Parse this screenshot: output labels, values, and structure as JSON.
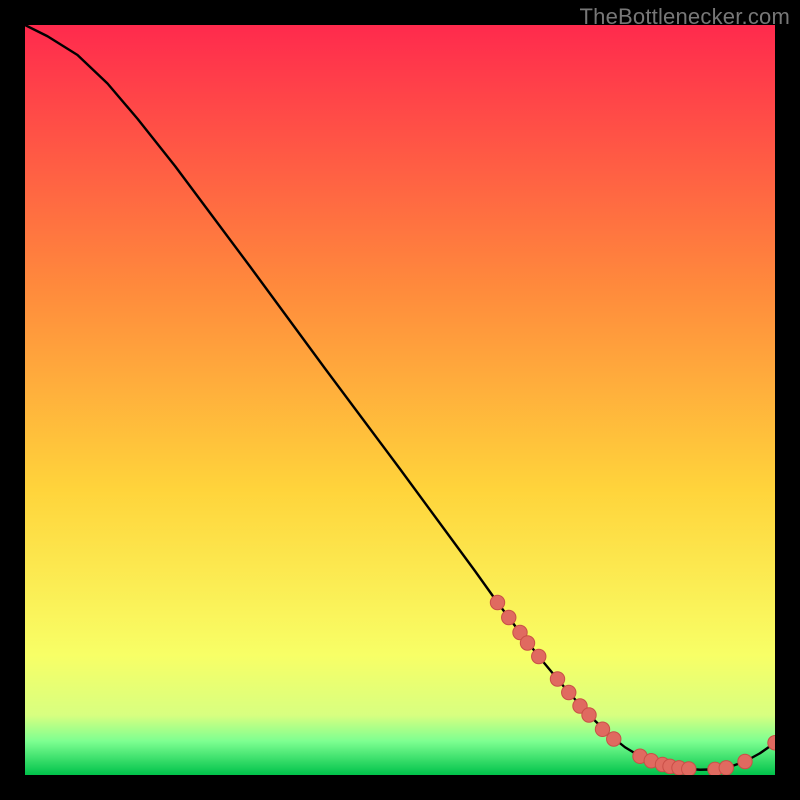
{
  "attribution": "TheBottlenecker.com",
  "colors": {
    "bg": "#000000",
    "grad_top": "#ff2a4d",
    "grad_mid1": "#ff6a3c",
    "grad_mid2": "#ffd43b",
    "grad_low": "#f8ff66",
    "grad_band": "#7dff91",
    "grad_bottom": "#00c24a",
    "curve": "#000000",
    "dot_fill": "#e06a60",
    "dot_stroke": "#c94f47"
  },
  "chart_data": {
    "type": "line",
    "title": "",
    "xlabel": "",
    "ylabel": "",
    "xlim": [
      0,
      100
    ],
    "ylim": [
      0,
      100
    ],
    "series": [
      {
        "name": "bottleneck-curve",
        "x": [
          0,
          3,
          7,
          11,
          15,
          20,
          25,
          30,
          35,
          40,
          45,
          50,
          55,
          60,
          63,
          66,
          69,
          72,
          75,
          78,
          80,
          82,
          84,
          86,
          88,
          90,
          92,
          94,
          96,
          98,
          100
        ],
        "y": [
          100,
          98.5,
          96,
          92.2,
          87.5,
          81.2,
          74.5,
          67.8,
          61,
          54.2,
          47.5,
          40.8,
          34,
          27.2,
          23,
          19,
          15.2,
          11.6,
          8.2,
          5.3,
          3.7,
          2.5,
          1.7,
          1.15,
          0.85,
          0.7,
          0.75,
          1.1,
          1.8,
          2.9,
          4.3
        ]
      }
    ],
    "dots": [
      {
        "x": 63,
        "y": 23
      },
      {
        "x": 64.5,
        "y": 21
      },
      {
        "x": 66,
        "y": 19
      },
      {
        "x": 67,
        "y": 17.6
      },
      {
        "x": 68.5,
        "y": 15.8
      },
      {
        "x": 71,
        "y": 12.8
      },
      {
        "x": 72.5,
        "y": 11
      },
      {
        "x": 74,
        "y": 9.2
      },
      {
        "x": 75.2,
        "y": 8
      },
      {
        "x": 77,
        "y": 6.1
      },
      {
        "x": 78.5,
        "y": 4.8
      },
      {
        "x": 82,
        "y": 2.5
      },
      {
        "x": 83.5,
        "y": 1.9
      },
      {
        "x": 85,
        "y": 1.4
      },
      {
        "x": 86,
        "y": 1.15
      },
      {
        "x": 87.2,
        "y": 0.95
      },
      {
        "x": 88.5,
        "y": 0.8
      },
      {
        "x": 92,
        "y": 0.75
      },
      {
        "x": 93.5,
        "y": 0.95
      },
      {
        "x": 96,
        "y": 1.8
      },
      {
        "x": 100,
        "y": 4.3
      }
    ]
  }
}
